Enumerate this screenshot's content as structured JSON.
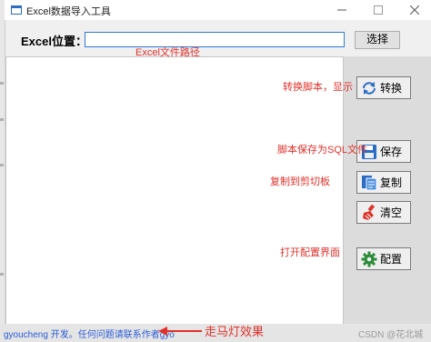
{
  "window": {
    "title": "Excel数据导入工具",
    "minimize_glyph": "—",
    "maximize_glyph": "☐",
    "close_glyph": "✕"
  },
  "form": {
    "path_label": "Excel位置：",
    "path_value": "",
    "select_label": "选择"
  },
  "buttons": {
    "convert": {
      "label": "转换",
      "icon": "refresh-icon",
      "color": "#2b6cc4"
    },
    "save": {
      "label": "保存",
      "icon": "save-icon",
      "color": "#2b6cc4"
    },
    "copy": {
      "label": "复制",
      "icon": "copy-icon",
      "color": "#2b6cc4"
    },
    "clear": {
      "label": "清空",
      "icon": "broom-icon",
      "color": "#d9352b"
    },
    "config": {
      "label": "配置",
      "icon": "gear-icon",
      "color": "#2e8b3a"
    }
  },
  "annotations": {
    "path": "Excel文件路径",
    "convert": "转换脚本，显示",
    "save": "脚本保存为SQL文件",
    "copy": "复制到剪切板",
    "config": "打开配置界面",
    "marquee": "走马灯效果",
    "color": "#e0312a"
  },
  "status": {
    "marquee_text": "gyoucheng 开发。任何问题请联系作者gyo",
    "watermark": "CSDN @花北城"
  }
}
